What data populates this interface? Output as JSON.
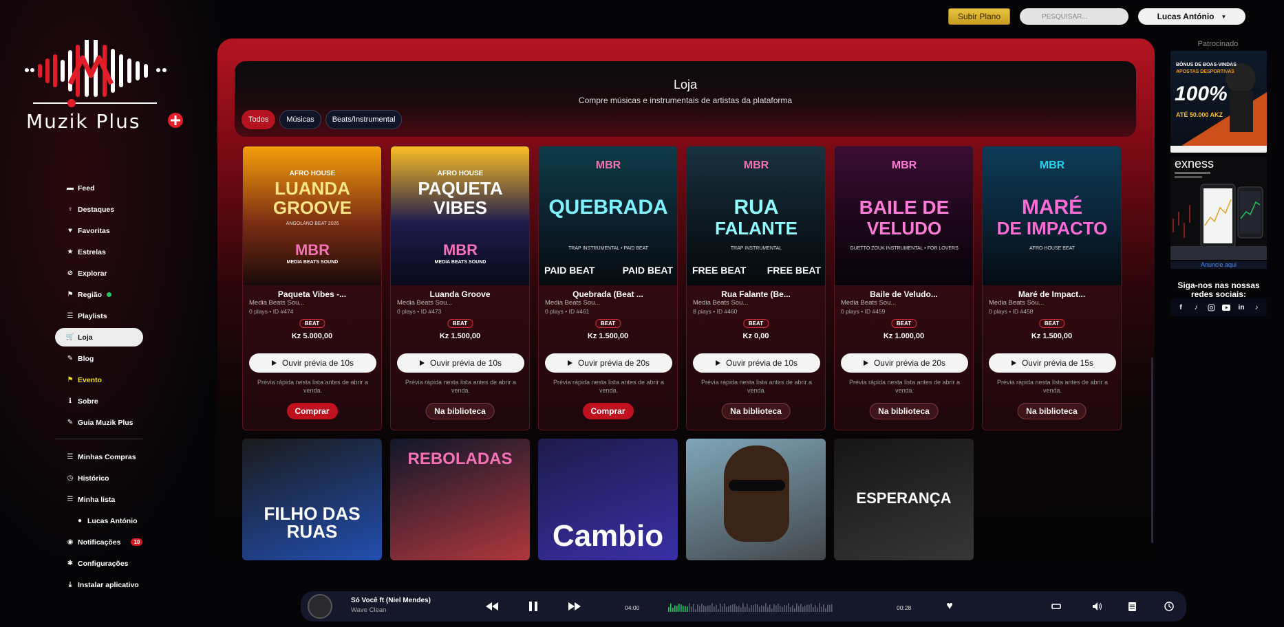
{
  "app": {
    "brand": "Muzik Plus"
  },
  "topbar": {
    "plan_button": "Subir Plano",
    "search_placeholder": "PESQUISAR...",
    "user_menu": "Lucas António"
  },
  "sidebar": {
    "items": [
      {
        "label": "Feed",
        "icon": "feed-icon"
      },
      {
        "label": "Destaques",
        "icon": "lightbulb-icon"
      },
      {
        "label": "Favoritas",
        "icon": "heart-icon"
      },
      {
        "label": "Estrelas",
        "icon": "star-icon"
      },
      {
        "label": "Explorar",
        "icon": "compass-icon"
      },
      {
        "label": "Região",
        "icon": "flag-icon",
        "online": true
      },
      {
        "label": "Playlists",
        "icon": "list-icon"
      },
      {
        "label": "Loja",
        "icon": "cart-icon",
        "active": true
      },
      {
        "label": "Blog",
        "icon": "blog-icon"
      },
      {
        "label": "Evento",
        "icon": "event-flag-icon",
        "color": "#f2e21b"
      },
      {
        "label": "Sobre",
        "icon": "info-icon"
      },
      {
        "label": "Guia Muzik Plus",
        "icon": "guide-icon"
      }
    ],
    "secondary": [
      {
        "label": "Minhas Compras",
        "icon": "list-icon"
      },
      {
        "label": "Histórico",
        "icon": "clock-icon"
      },
      {
        "label": "Minha lista",
        "icon": "list-icon"
      },
      {
        "label": "Lucas António",
        "icon": "user-icon"
      },
      {
        "label": "Notificações",
        "icon": "bell-icon",
        "badge": "10"
      },
      {
        "label": "Configurações",
        "icon": "gear-icon"
      },
      {
        "label": "Instalar aplicativo",
        "icon": "download-icon"
      }
    ]
  },
  "store": {
    "title": "Loja",
    "subtitle": "Compre músicas e instrumentais de artistas da plataforma",
    "filters": [
      {
        "label": "Todos",
        "active": true
      },
      {
        "label": "Músicas"
      },
      {
        "label": "Beats/Instrumental"
      }
    ],
    "products": [
      {
        "title": "Paqueta Vibes -...",
        "artist": "Media Beats Sou...",
        "meta": "0 plays  •  ID #474",
        "badge": "BEAT",
        "price": "Kz 5.000,00",
        "preview": "Ouvir prévia de 10s",
        "hint": "Prévia rápida nesta lista antes de abrir a venda.",
        "action": "Comprar",
        "action_type": "buy",
        "cover": {
          "top": "AFRO HOUSE",
          "l1": "LUANDA",
          "l2": "GROOVE",
          "sub": "ANGOLANO BEAT 2026",
          "logo": "MBR",
          "logo_sub": "MEDIA BEATS SOUND"
        }
      },
      {
        "title": "Luanda Groove",
        "artist": "Media Beats Sou...",
        "meta": "0 plays  •  ID #473",
        "badge": "BEAT",
        "price": "Kz 1.500,00",
        "preview": "Ouvir prévia de 10s",
        "hint": "Prévia rápida nesta lista antes de abrir a venda.",
        "action": "Na biblioteca",
        "action_type": "library",
        "cover": {
          "top": "AFRO HOUSE",
          "l1": "PAQUETA",
          "l2": "VIBES",
          "logo": "MBR",
          "logo_sub": "MEDIA BEATS SOUND"
        }
      },
      {
        "title": "Quebrada (Beat ...",
        "artist": "Media Beats Sou...",
        "meta": "0 plays  •  ID #461",
        "badge": "BEAT",
        "price": "Kz 1.500,00",
        "preview": "Ouvir prévia de 20s",
        "hint": "Prévia rápida nesta lista antes de abrir a venda.",
        "action": "Comprar",
        "action_type": "buy",
        "cover": {
          "logo": "MBR",
          "l1": "QUEBRADA",
          "sub": "TRAP INSTRUMENTAL • PAID BEAT",
          "corner_l": "PAID BEAT",
          "corner_r": "PAID BEAT"
        }
      },
      {
        "title": "Rua Falante (Be...",
        "artist": "Media Beats Sou...",
        "meta": "8 plays  •  ID #460",
        "badge": "BEAT",
        "price": "Kz 0,00",
        "preview": "Ouvir prévia de 10s",
        "hint": "Prévia rápida nesta lista antes de abrir a venda.",
        "action": "Na biblioteca",
        "action_type": "library",
        "cover": {
          "logo": "MBR",
          "l1": "RUA",
          "l2": "FALANTE",
          "sub": "TRAP INSTRUMENTAL",
          "corner_l": "FREE BEAT",
          "corner_r": "FREE BEAT"
        }
      },
      {
        "title": "Baile de Veludo...",
        "artist": "Media Beats Sou...",
        "meta": "0 plays  •  ID #459",
        "badge": "BEAT",
        "price": "Kz 1.000,00",
        "preview": "Ouvir prévia de 20s",
        "hint": "Prévia rápida nesta lista antes de abrir a venda.",
        "action": "Na biblioteca",
        "action_type": "library",
        "cover": {
          "logo": "MBR",
          "l1": "BAILE DE",
          "l2": "VELUDO",
          "sub": "GUETTO ZOUK INSTRUMENTAL • FOR LOVERS"
        }
      },
      {
        "title": "Maré de Impact...",
        "artist": "Media Beats Sou...",
        "meta": "0 plays  •  ID #458",
        "badge": "BEAT",
        "price": "Kz 1.500,00",
        "preview": "Ouvir prévia de 15s",
        "hint": "Prévia rápida nesta lista antes de abrir a venda.",
        "action": "Na biblioteca",
        "action_type": "library",
        "cover": {
          "logo": "MBR",
          "l1": "MARÉ",
          "l2": "DE IMPACTO",
          "sub": "AFRO HOUSE BEAT"
        }
      }
    ],
    "second_row": [
      {
        "cover_text": "FILHO DAS RUAS"
      },
      {
        "cover_text": "REBOLADAS"
      },
      {
        "cover_text": "Cambio"
      },
      {
        "cover_text": ""
      },
      {
        "cover_text": "ESPERANÇA"
      }
    ]
  },
  "sponsored": {
    "title": "Patrocinado",
    "ad1": {
      "top": "BÓNUS DE BOAS-VINDAS",
      "l2": "APOSTAS DESPORTIVAS",
      "big": "100%",
      "amount": "ATÉ 50.000 AKZ"
    },
    "ad2": {
      "brand": "exness"
    },
    "link": "Anuncie aqui",
    "follow": "Siga-nos nas nossas redes sociais:",
    "socials": [
      "facebook-icon",
      "tiktok-icon",
      "instagram-icon",
      "youtube-icon",
      "linkedin-icon",
      "tiktok-icon"
    ]
  },
  "player": {
    "title": "Só Você ft (Niel Mendes)",
    "artist": "Wave Clean",
    "elapsed": "04:00",
    "remaining": "00:28",
    "progress": 0.12
  }
}
